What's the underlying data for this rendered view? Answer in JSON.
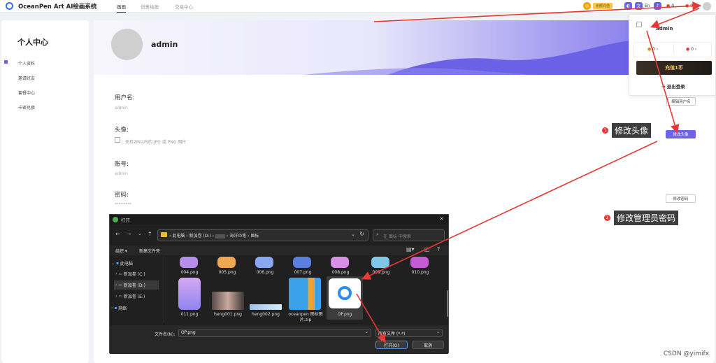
{
  "app": {
    "name": "OceanPen Art AI绘画系统"
  },
  "nav": [
    {
      "label": "画画"
    },
    {
      "label": "创意绘画"
    },
    {
      "label": "交易中心"
    }
  ],
  "topbar": {
    "recharge_label": "余额充值",
    "lang_label": "En",
    "counter_a": "0",
    "counter_b": "0"
  },
  "sidebar": {
    "title": "个人中心",
    "items": [
      {
        "label": "个人资料"
      },
      {
        "label": "邀请好友"
      },
      {
        "label": "套餐中心"
      },
      {
        "label": "卡密兑换"
      }
    ]
  },
  "profile": {
    "username": "admin",
    "fields": [
      {
        "label": "用户名:",
        "value": "admin",
        "button": "编辑用户名"
      },
      {
        "label": "头像:",
        "hint": "：支持2M以内的 JPG 或 PNG 图片",
        "button": "修改头像"
      },
      {
        "label": "账号:",
        "value": "admin"
      },
      {
        "label": "密码:",
        "value": "********",
        "button": "修改密码"
      }
    ]
  },
  "dropdown": {
    "username": "admin",
    "stat_a": "0",
    "stat_b": "0",
    "recharge_label": "充值1币",
    "logout_label": "退出登录"
  },
  "annotations": [
    {
      "num": "1",
      "text": "修改头像"
    },
    {
      "num": "2",
      "text": "修改管理员密码"
    }
  ],
  "dialog": {
    "title": "打开",
    "breadcrumb": [
      "此电脑",
      "新加卷 (D:)",
      "海洋の笔",
      "图标"
    ],
    "search_placeholder": "在 图标 中搜索",
    "organize_label": "组织 ▾",
    "newfolder_label": "新建文件夹",
    "tree": [
      {
        "label": "此电脑"
      },
      {
        "label": "新加卷 (C:)"
      },
      {
        "label": "新加卷 (D:)"
      },
      {
        "label": "新加卷 (E:)"
      },
      {
        "label": "网络"
      }
    ],
    "files_row1": [
      "004.png",
      "005.png",
      "006.png",
      "007.png",
      "008.png",
      "009.png",
      "010.png"
    ],
    "files_row2": [
      "011.png",
      "heng001.png",
      "heng002.png",
      "oceanpen 图标图片.zip",
      "OP.png"
    ],
    "filename_label": "文件名(N):",
    "filename_value": "OP.png",
    "filetype_value": "所有文件 (*.*)",
    "open_label": "打开(O)",
    "cancel_label": "取消"
  },
  "watermark": "CSDN @yimifx",
  "colors": {
    "accent": "#6d63e8",
    "annotation_red": "#e53935",
    "dialog_bg": "#202020"
  }
}
